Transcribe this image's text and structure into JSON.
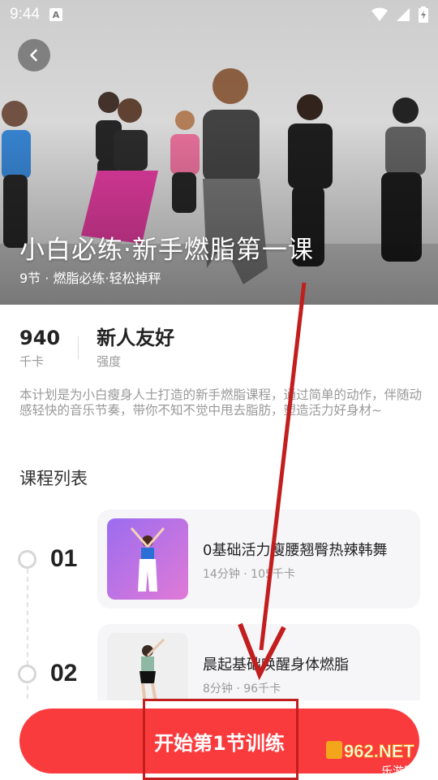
{
  "status_bar": {
    "time": "9:44",
    "badge": "A"
  },
  "hero": {
    "title": "小白必练·新手燃脂第一课",
    "subtitle": "9节 · 燃脂必练·轻松掉秤"
  },
  "stats": [
    {
      "value": "940",
      "label": "千卡"
    },
    {
      "value": "新人友好",
      "label": "强度"
    }
  ],
  "description": "本计划是为小白瘦身人士打造的新手燃脂课程，通过简单的动作，伴随动感轻快的音乐节奏，带你不知不觉中甩去脂肪，塑造活力好身材~",
  "section_title": "课程列表",
  "courses": [
    {
      "num": "01",
      "title": "0基础活力瘦腰翘臀热辣韩舞",
      "meta": "14分钟 · 105千卡"
    },
    {
      "num": "02",
      "title": "晨起基础唤醒身体燃脂",
      "meta": "8分钟 · 96千卡"
    }
  ],
  "start_button": {
    "label": "开始第1节训练"
  },
  "watermark": {
    "text": "962.NET",
    "sub": "乐游网"
  },
  "colors": {
    "accent": "#fa3b3e",
    "annotation": "#c21e1e"
  },
  "icons": {
    "back": "chevron-left-icon",
    "wifi": "wifi-icon",
    "signal": "signal-icon",
    "battery": "battery-icon"
  }
}
